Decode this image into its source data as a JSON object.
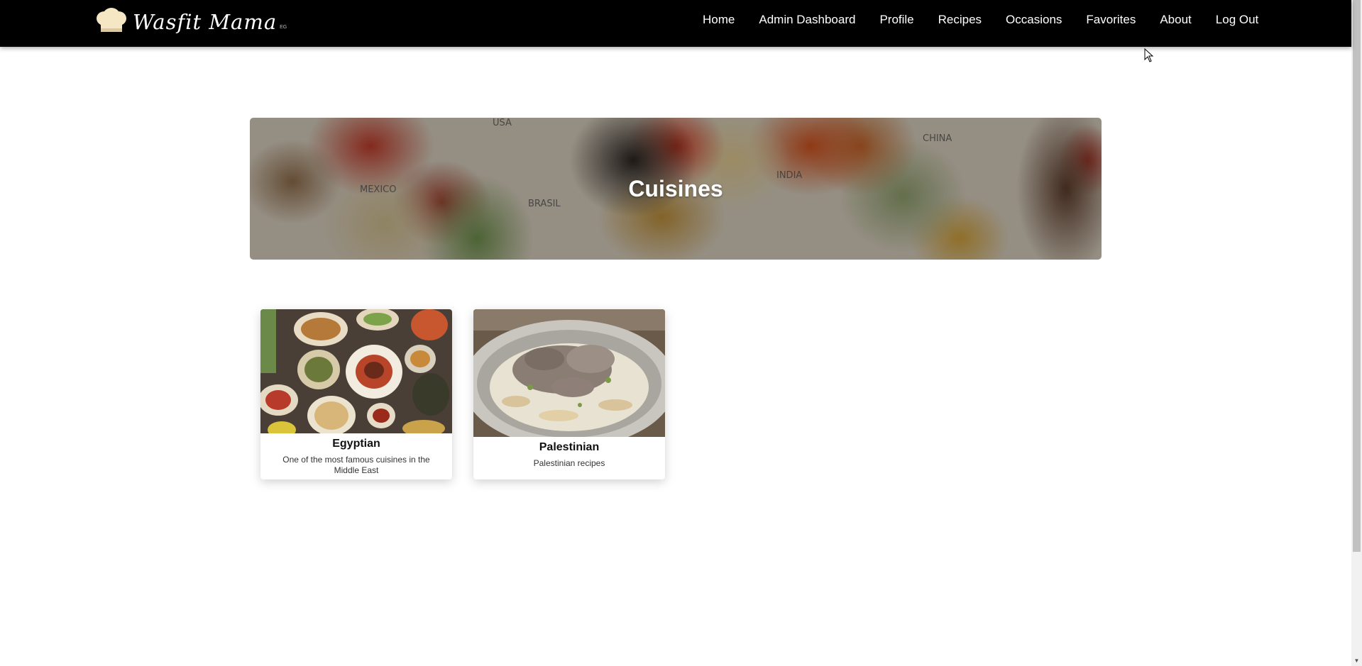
{
  "brand": {
    "name": "Wasfit Mama",
    "suffix": "EG",
    "icon": "chef-hat-icon"
  },
  "nav": {
    "items": [
      {
        "label": "Home"
      },
      {
        "label": "Admin Dashboard"
      },
      {
        "label": "Profile"
      },
      {
        "label": "Recipes"
      },
      {
        "label": "Occasions"
      },
      {
        "label": "Favorites"
      },
      {
        "label": "About"
      },
      {
        "label": "Log Out"
      }
    ]
  },
  "hero": {
    "title": "Cuisines",
    "map_labels": [
      "USA",
      "MEXICO",
      "BRASIL",
      "INDIA",
      "CHINA"
    ]
  },
  "cuisines": [
    {
      "name": "Egyptian",
      "description": "One of the most famous cuisines in the Middle East",
      "image": "egyptian-dishes-photo"
    },
    {
      "name": "Palestinian",
      "description": "Palestinian recipes",
      "image": "palestinian-dish-photo"
    }
  ],
  "colors": {
    "navbar_bg": "#000000",
    "nav_text": "#ffffff",
    "brand_hat": "#f5e6c4",
    "page_bg": "#ffffff"
  }
}
